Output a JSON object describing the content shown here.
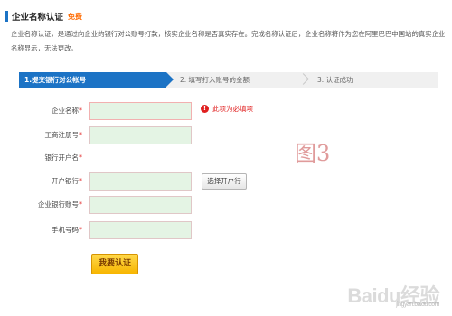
{
  "header": {
    "title": "企业名称认证",
    "badge": "免费",
    "description_line1": "企业名称认证，是通过向企业的银行对公账号打款，核实企业名称是否真实存在。完成名称认证后，企业名称将作为您在阿里巴巴中国站的真实企业",
    "description_line2": "名称显示，无法更改。"
  },
  "steps": [
    {
      "label": "1.提交银行对公帐号",
      "active": true
    },
    {
      "label": "2. 填写打入账号的金额",
      "active": false
    },
    {
      "label": "3. 认证成功",
      "active": false
    }
  ],
  "form": {
    "fields": [
      {
        "label": "企业名称",
        "required_mark": "*",
        "value": ""
      },
      {
        "label": "工商注册号",
        "required_mark": "*",
        "value": ""
      },
      {
        "label": "银行开户名",
        "required_mark": "*"
      },
      {
        "label": "开户银行",
        "required_mark": "*",
        "value": ""
      },
      {
        "label": "企业银行账号",
        "required_mark": "*",
        "value": ""
      },
      {
        "label": "手机号码",
        "required_mark": "*",
        "value": ""
      }
    ],
    "error_icon": "!",
    "error_text": "此项为必填项",
    "choose_bank_label": "选择开户行",
    "submit_label": "我要认证"
  },
  "annotation": "图3",
  "watermark": {
    "main": "Baidu经验",
    "sub": "jingyan.baidu.com"
  },
  "colors": {
    "accent": "#1c73c5",
    "required": "#e02020",
    "free_badge": "#ff6a00",
    "input_bg": "#e4f4e4",
    "submit_bg": "#f7b500"
  }
}
